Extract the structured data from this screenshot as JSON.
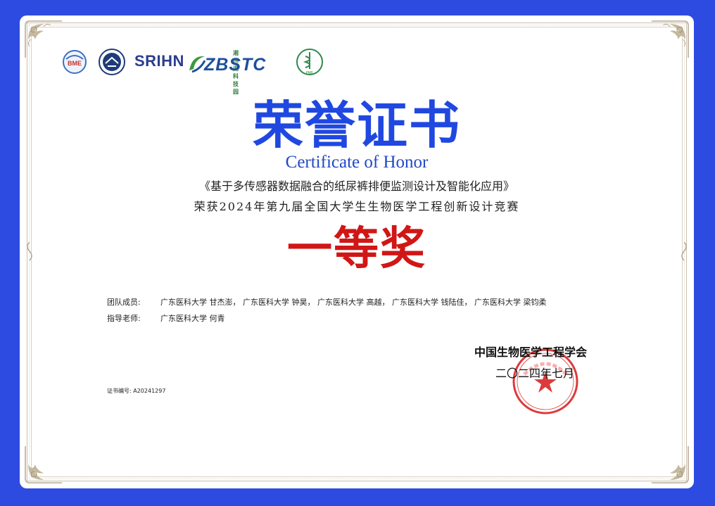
{
  "logos": {
    "bme": "BME",
    "srihn": "SRIHN",
    "zbstc": "ZBSTC",
    "zbstc_sub": "湘州湖科技园",
    "pme": "PME"
  },
  "certificate": {
    "title_cn": "荣誉证书",
    "title_en": "Certificate of Honor",
    "project": "《基于多传感器数据融合的纸尿裤排便监测设计及智能化应用》",
    "competition": "荣获2024年第九届全国大学生生物医学工程创新设计竞赛",
    "award": "一等奖"
  },
  "team": {
    "label": "团队成员:",
    "members": "广东医科大学 甘杰澎， 广东医科大学 钟昊， 广东医科大学 高越， 广东医科大学 钱陆佳， 广东医科大学 梁钧柔"
  },
  "advisor": {
    "label": "指导老师:",
    "name": "广东医科大学 何青"
  },
  "cert_number": "证书编号: A20241297",
  "issuer": "中国生物医学工程学会",
  "date": "二〇二四年七月",
  "colors": {
    "background": "#2d4be0",
    "title": "#2048e0",
    "award": "#d11616",
    "seal": "#d61a1a"
  }
}
